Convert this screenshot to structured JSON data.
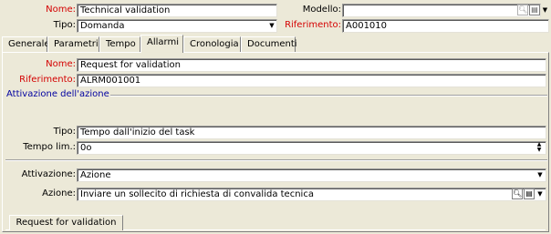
{
  "header": {
    "nome_label": "Nome:",
    "nome_value": "Technical validation",
    "modello_label": "Modello:",
    "modello_value": "",
    "tipo_label": "Tipo:",
    "tipo_value": "Domanda",
    "riferimento_label": "Riferimento:",
    "riferimento_value": "A001010"
  },
  "tabs": [
    {
      "label": "Generale"
    },
    {
      "label": "Parametri"
    },
    {
      "label": "Tempo"
    },
    {
      "label": "Allarmi"
    },
    {
      "label": "Cronologia"
    },
    {
      "label": "Documenti"
    }
  ],
  "alarm": {
    "nome_label": "Nome:",
    "nome_value": "Request for validation",
    "riferimento_label": "Riferimento:",
    "riferimento_value": "ALRM001001",
    "group_title": "Attivazione dell'azione",
    "tipo_label": "Tipo:",
    "tipo_value": "Tempo dall'inizio del task",
    "tempo_label": "Tempo lim.:",
    "tempo_value": "0o",
    "attivazione_label": "Attivazione:",
    "attivazione_value": "Azione",
    "azione_label": "Azione:",
    "azione_value": "Inviare un sollecito di richiesta di convalida tecnica"
  },
  "bottom_tab": {
    "label": "Request for validation"
  },
  "colors": {
    "required_label": "#d40000",
    "group_title": "#0000a0",
    "background": "#ece9d8"
  },
  "icons": {
    "search": "magnifier-icon",
    "detail": "detail-icon",
    "dropdown": "chevron-down-icon"
  }
}
